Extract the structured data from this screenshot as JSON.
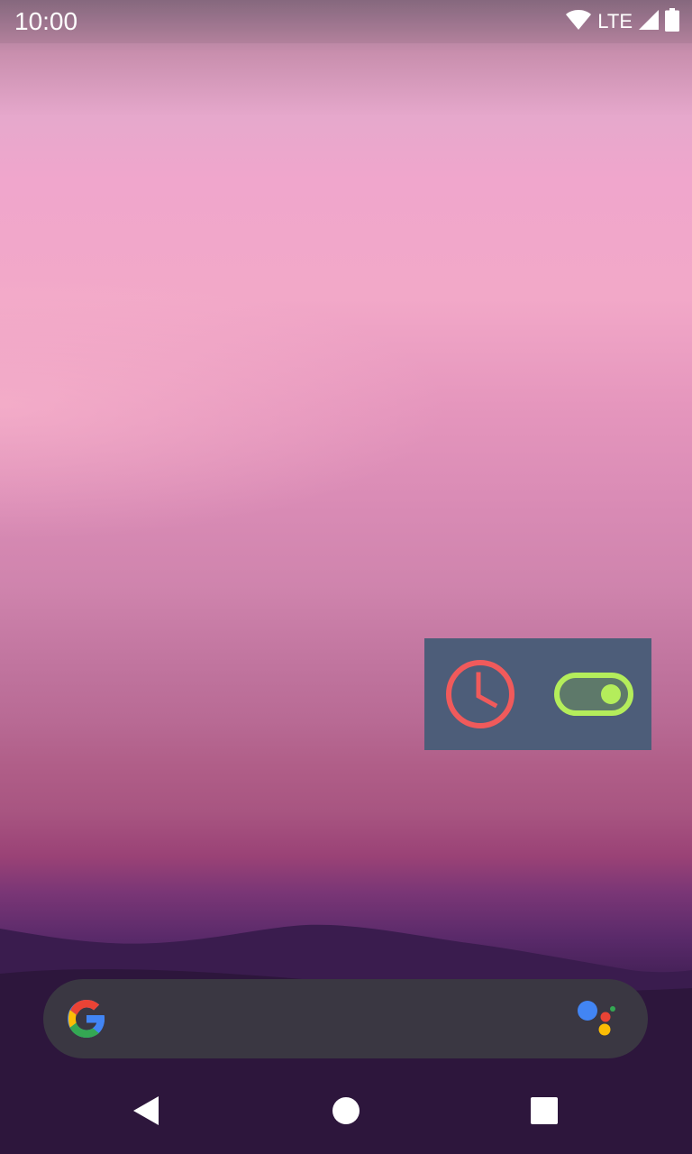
{
  "status_bar": {
    "time": "10:00",
    "network_label": "LTE",
    "icons": [
      "wifi-icon",
      "cellular-signal-icon",
      "battery-icon"
    ]
  },
  "widget": {
    "icons": [
      "clock-icon",
      "toggle-switch-icon"
    ],
    "toggle_state": "on",
    "colors": {
      "background": "#4b5d79",
      "clock": "#f25a5a",
      "toggle": "#b4f05a"
    }
  },
  "search_bar": {
    "icons": [
      "google-g-icon",
      "assistant-icon"
    ]
  },
  "nav_bar": {
    "buttons": [
      "back-button",
      "home-button",
      "recents-button"
    ]
  }
}
